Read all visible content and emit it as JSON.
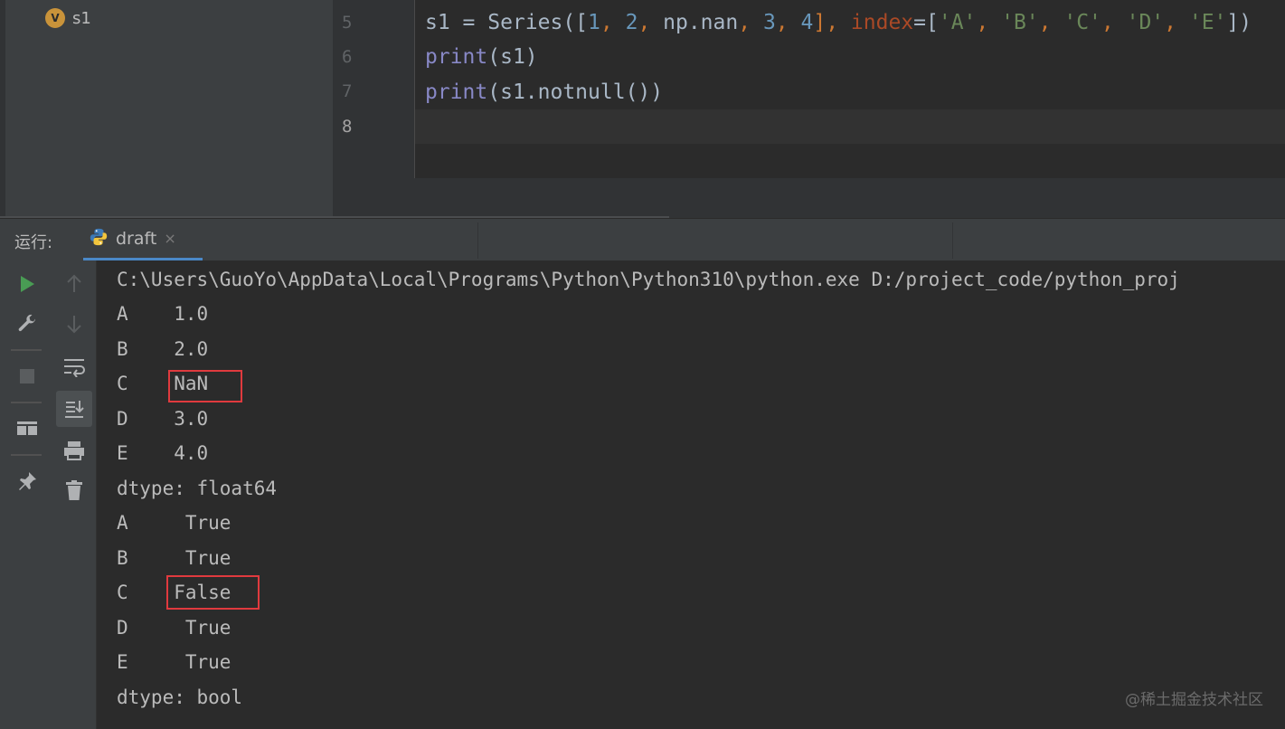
{
  "structure": {
    "variable_badge": "V",
    "variable_name": "s1"
  },
  "editor": {
    "line_numbers": [
      "5",
      "6",
      "7",
      "8"
    ],
    "code": {
      "line5": {
        "a": "s1 = Series([",
        "n1": "1",
        "c1": ", ",
        "n2": "2",
        "c2": ", ",
        "b": "np.nan",
        "c3": ", ",
        "n3": "3",
        "c4": ", ",
        "n4": "4",
        "c5": "], ",
        "param": "index",
        "eq": "=[",
        "sA": "'A'",
        "d1": ", ",
        "sB": "'B'",
        "d2": ", ",
        "sC": "'C'",
        "d3": ", ",
        "sD": "'D'",
        "d4": ", ",
        "sE": "'E'",
        "end": "])"
      },
      "line6": {
        "fn": "print",
        "rest": "(s1)"
      },
      "line7": {
        "fn": "print",
        "rest": "(s1.notnull())"
      }
    }
  },
  "run_panel": {
    "label": "运行:",
    "tab_name": "draft",
    "tab_close": "×",
    "icons": [
      "run-icon",
      "wrench-icon",
      "stop-icon",
      "layout-icon",
      "pin-icon",
      "arrow-up-icon",
      "arrow-down-icon",
      "soft-wrap-icon",
      "scroll-to-end-icon",
      "print-icon",
      "trash-icon"
    ]
  },
  "console": {
    "lines": [
      "C:\\Users\\GuoYo\\AppData\\Local\\Programs\\Python\\Python310\\python.exe D:/project_code/python_proj",
      "A    1.0",
      "B    2.0",
      "C    NaN",
      "D    3.0",
      "E    4.0",
      "dtype: float64",
      "A     True",
      "B     True",
      "C    False",
      "D     True",
      "E     True",
      "dtype: bool"
    ]
  },
  "colors": {
    "highlight_box": "#e03a3e",
    "run_green": "#499c54",
    "tab_underline": "#4a88c7"
  },
  "watermark": "@稀土掘金技术社区"
}
